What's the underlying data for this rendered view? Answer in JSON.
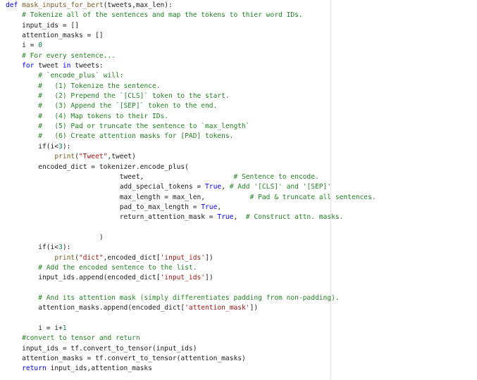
{
  "lines": [
    [
      {
        "t": "def ",
        "c": "kw"
      },
      {
        "t": "mask_inputs_for_bert",
        "c": "fn"
      },
      {
        "t": "(tweets,max_len):",
        "c": "id"
      }
    ],
    [
      {
        "t": "    ",
        "c": "id"
      },
      {
        "t": "# Tokenize all of the sentences and map the tokens to thier word IDs.",
        "c": "cm"
      }
    ],
    [
      {
        "t": "    input_ids = []",
        "c": "id"
      }
    ],
    [
      {
        "t": "    attention_masks = []",
        "c": "id"
      }
    ],
    [
      {
        "t": "    i = ",
        "c": "id"
      },
      {
        "t": "0",
        "c": "num"
      }
    ],
    [
      {
        "t": "    ",
        "c": "id"
      },
      {
        "t": "# For every sentence...",
        "c": "cm"
      }
    ],
    [
      {
        "t": "    ",
        "c": "id"
      },
      {
        "t": "for ",
        "c": "kw"
      },
      {
        "t": "tweet ",
        "c": "id"
      },
      {
        "t": "in ",
        "c": "kw"
      },
      {
        "t": "tweets:",
        "c": "id"
      }
    ],
    [
      {
        "t": "        ",
        "c": "id"
      },
      {
        "t": "# `encode_plus` will:",
        "c": "cm"
      }
    ],
    [
      {
        "t": "        ",
        "c": "id"
      },
      {
        "t": "#   (1) Tokenize the sentence.",
        "c": "cm"
      }
    ],
    [
      {
        "t": "        ",
        "c": "id"
      },
      {
        "t": "#   (2) Prepend the `[CLS]` token to the start.",
        "c": "cm"
      }
    ],
    [
      {
        "t": "        ",
        "c": "id"
      },
      {
        "t": "#   (3) Append the `[SEP]` token to the end.",
        "c": "cm"
      }
    ],
    [
      {
        "t": "        ",
        "c": "id"
      },
      {
        "t": "#   (4) Map tokens to their IDs.",
        "c": "cm"
      }
    ],
    [
      {
        "t": "        ",
        "c": "id"
      },
      {
        "t": "#   (5) Pad or truncate the sentence to `max_length`",
        "c": "cm"
      }
    ],
    [
      {
        "t": "        ",
        "c": "id"
      },
      {
        "t": "#   (6) Create attention masks for [PAD] tokens.",
        "c": "cm"
      }
    ],
    [
      {
        "t": "        if(i<",
        "c": "id"
      },
      {
        "t": "3",
        "c": "num"
      },
      {
        "t": "):",
        "c": "id"
      }
    ],
    [
      {
        "t": "            ",
        "c": "id"
      },
      {
        "t": "print",
        "c": "fn"
      },
      {
        "t": "(",
        "c": "id"
      },
      {
        "t": "\"Tweet\"",
        "c": "str"
      },
      {
        "t": ",tweet)",
        "c": "id"
      }
    ],
    [
      {
        "t": "        encoded_dict = tokenizer.encode_plus(",
        "c": "id"
      }
    ],
    [
      {
        "t": "                            tweet,                      ",
        "c": "id"
      },
      {
        "t": "# Sentence to encode.",
        "c": "cm"
      }
    ],
    [
      {
        "t": "                            add_special_tokens = ",
        "c": "id"
      },
      {
        "t": "True",
        "c": "bool"
      },
      {
        "t": ", ",
        "c": "id"
      },
      {
        "t": "# Add '[CLS]' and '[SEP]'",
        "c": "cm"
      }
    ],
    [
      {
        "t": "                            max_length = max_len,           ",
        "c": "id"
      },
      {
        "t": "# Pad & truncate all sentences.",
        "c": "cm"
      }
    ],
    [
      {
        "t": "                            pad_to_max_length = ",
        "c": "id"
      },
      {
        "t": "True",
        "c": "bool"
      },
      {
        "t": ",",
        "c": "id"
      }
    ],
    [
      {
        "t": "                            return_attention_mask = ",
        "c": "id"
      },
      {
        "t": "True",
        "c": "bool"
      },
      {
        "t": ",  ",
        "c": "id"
      },
      {
        "t": "# Construct attn. masks.",
        "c": "cm"
      }
    ],
    [
      {
        "t": "",
        "c": "id"
      }
    ],
    [
      {
        "t": "                       )",
        "c": "id"
      }
    ],
    [
      {
        "t": "        if(i<",
        "c": "id"
      },
      {
        "t": "3",
        "c": "num"
      },
      {
        "t": "):",
        "c": "id"
      }
    ],
    [
      {
        "t": "            ",
        "c": "id"
      },
      {
        "t": "print",
        "c": "fn"
      },
      {
        "t": "(",
        "c": "id"
      },
      {
        "t": "\"dict\"",
        "c": "str"
      },
      {
        "t": ",encoded_dict[",
        "c": "id"
      },
      {
        "t": "'input_ids'",
        "c": "str"
      },
      {
        "t": "])",
        "c": "id"
      }
    ],
    [
      {
        "t": "        ",
        "c": "id"
      },
      {
        "t": "# Add the encoded sentence to the list.",
        "c": "cm"
      }
    ],
    [
      {
        "t": "        input_ids.append(encoded_dict[",
        "c": "id"
      },
      {
        "t": "'input_ids'",
        "c": "str"
      },
      {
        "t": "])",
        "c": "id"
      }
    ],
    [
      {
        "t": "",
        "c": "id"
      }
    ],
    [
      {
        "t": "        ",
        "c": "id"
      },
      {
        "t": "# And its attention mask (simply differentiates padding from non-padding).",
        "c": "cm"
      }
    ],
    [
      {
        "t": "        attention_masks.append(encoded_dict[",
        "c": "id"
      },
      {
        "t": "'attention_mask'",
        "c": "str"
      },
      {
        "t": "])",
        "c": "id"
      }
    ],
    [
      {
        "t": "",
        "c": "id"
      }
    ],
    [
      {
        "t": "        i = i+",
        "c": "id"
      },
      {
        "t": "1",
        "c": "num"
      }
    ],
    [
      {
        "t": "    ",
        "c": "id"
      },
      {
        "t": "#convert to tensor and return",
        "c": "cm"
      }
    ],
    [
      {
        "t": "    input_ids = tf.convert_to_tensor(input_ids)",
        "c": "id"
      }
    ],
    [
      {
        "t": "    attention_masks = tf.convert_to_tensor(attention_masks)",
        "c": "id"
      }
    ],
    [
      {
        "t": "    ",
        "c": "id"
      },
      {
        "t": "return ",
        "c": "kw"
      },
      {
        "t": "input_ids,attention_masks",
        "c": "id"
      }
    ]
  ]
}
